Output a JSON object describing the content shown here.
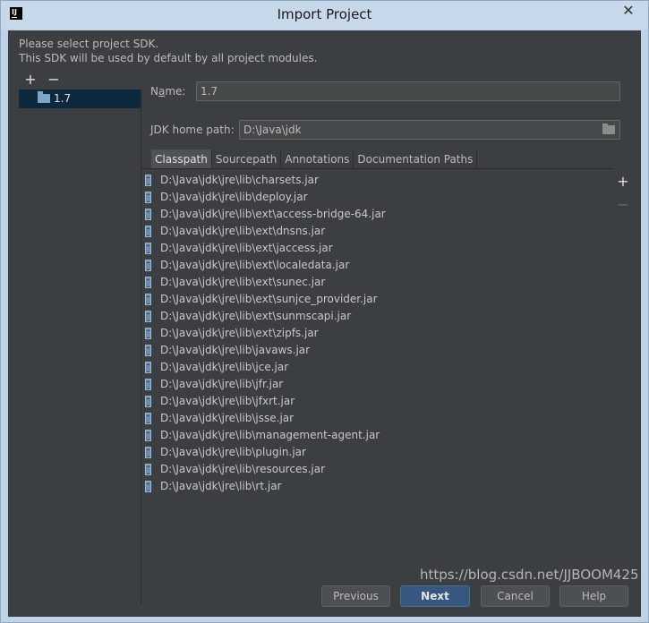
{
  "window": {
    "title": "Import Project",
    "app_icon_text": "IJ",
    "close_glyph": "✕"
  },
  "intro": {
    "line1": "Please select project SDK.",
    "line2": "This SDK will be used by default by all project modules."
  },
  "toolbar": {
    "add_glyph": "+",
    "remove_glyph": "−"
  },
  "sdk_list": [
    {
      "label": "1.7",
      "icon": "folder-icon",
      "selected": true
    }
  ],
  "name_field": {
    "label_pre": "N",
    "label_underlined": "a",
    "label_post": "me:",
    "value": "1.7"
  },
  "jdk_home": {
    "label": "JDK home path:",
    "value": "D:\\Java\\jdk",
    "icon": "browse-folder-icon"
  },
  "tabs": [
    {
      "label": "Classpath",
      "active": true
    },
    {
      "label": "Sourcepath",
      "active": false
    },
    {
      "label": "Annotations",
      "active": false
    },
    {
      "label": "Documentation Paths",
      "active": false
    }
  ],
  "classpath": [
    "D:\\Java\\jdk\\jre\\lib\\charsets.jar",
    "D:\\Java\\jdk\\jre\\lib\\deploy.jar",
    "D:\\Java\\jdk\\jre\\lib\\ext\\access-bridge-64.jar",
    "D:\\Java\\jdk\\jre\\lib\\ext\\dnsns.jar",
    "D:\\Java\\jdk\\jre\\lib\\ext\\jaccess.jar",
    "D:\\Java\\jdk\\jre\\lib\\ext\\localedata.jar",
    "D:\\Java\\jdk\\jre\\lib\\ext\\sunec.jar",
    "D:\\Java\\jdk\\jre\\lib\\ext\\sunjce_provider.jar",
    "D:\\Java\\jdk\\jre\\lib\\ext\\sunmscapi.jar",
    "D:\\Java\\jdk\\jre\\lib\\ext\\zipfs.jar",
    "D:\\Java\\jdk\\jre\\lib\\javaws.jar",
    "D:\\Java\\jdk\\jre\\lib\\jce.jar",
    "D:\\Java\\jdk\\jre\\lib\\jfr.jar",
    "D:\\Java\\jdk\\jre\\lib\\jfxrt.jar",
    "D:\\Java\\jdk\\jre\\lib\\jsse.jar",
    "D:\\Java\\jdk\\jre\\lib\\management-agent.jar",
    "D:\\Java\\jdk\\jre\\lib\\plugin.jar",
    "D:\\Java\\jdk\\jre\\lib\\resources.jar",
    "D:\\Java\\jdk\\jre\\lib\\rt.jar"
  ],
  "side_buttons": {
    "add_glyph": "+",
    "remove_glyph": "−"
  },
  "buttons": {
    "previous": "Previous",
    "next": "Next",
    "cancel": "Cancel",
    "help": "Help"
  },
  "watermark": "https://blog.csdn.net/JJBOOM425",
  "colors": {
    "panel_bg": "#3c3f41",
    "selection": "#0d293e",
    "primary_button": "#365880",
    "title_bar": "#c7d8ea"
  }
}
